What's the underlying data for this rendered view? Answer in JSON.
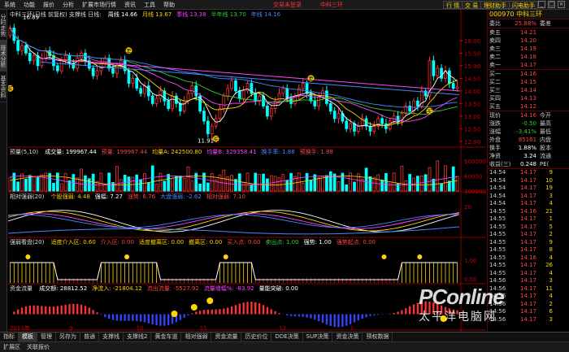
{
  "menubar": {
    "items": [
      "系统",
      "功能",
      "报价",
      "分析",
      "扩展市场行情",
      "资讯",
      "工具",
      "帮助"
    ],
    "login": "交易未登录",
    "company": "中科三环",
    "buttons": [
      "行 情",
      "交 易",
      "理财助手",
      "闪电助手"
    ]
  },
  "left_tabs": [
    "分时走势",
    "技术分析",
    "基本资料"
  ],
  "kline": {
    "title": "中科三环(日线 前复权) 支撑线 日线:",
    "ma_labels": [
      {
        "name": "周线",
        "value": "14.66",
        "color": "#ffffff"
      },
      {
        "name": "月线",
        "value": "13.67",
        "color": "#ffd400"
      },
      {
        "name": "季线",
        "value": "13.38",
        "color": "#ff44ff"
      },
      {
        "name": "半年线",
        "value": "13.70",
        "color": "#33cc33"
      },
      {
        "name": "年线",
        "value": "14.16",
        "color": "#4488ff"
      }
    ],
    "high_label": "16.89",
    "low_label": "11.91",
    "y_ticks": [
      "16.00",
      "15.50",
      "15.00",
      "14.50",
      "14.00",
      "13.50",
      "13.00",
      "12.50",
      "12.00"
    ],
    "series": {
      "open": [
        16.2,
        16.5,
        16.0,
        15.6,
        15.8,
        15.5,
        15.2,
        15.4,
        15.0,
        15.3,
        15.6,
        15.4,
        15.0,
        14.8,
        15.2,
        15.4,
        15.1,
        14.9,
        15.3,
        15.5,
        15.2,
        14.9,
        14.6,
        14.8,
        15.1,
        15.3,
        14.9,
        14.7,
        15.0,
        15.2,
        14.8,
        14.3,
        14.5,
        14.1,
        13.9,
        14.2,
        13.8,
        13.5,
        13.7,
        14.0,
        13.6,
        13.3,
        13.8,
        13.5,
        13.2,
        13.6,
        13.9,
        14.2,
        13.8,
        13.2,
        12.8,
        12.3,
        12.6,
        12.9,
        13.3,
        13.8,
        14.1,
        14.4,
        14.0,
        13.7,
        14.0,
        14.3,
        13.9,
        13.6,
        13.8,
        13.4,
        13.0,
        13.3,
        13.6,
        13.9,
        14.1,
        13.7,
        13.5,
        13.8,
        14.1,
        14.3,
        13.9,
        13.6,
        13.4,
        13.8,
        14.0,
        13.5,
        13.2,
        12.9,
        13.1,
        12.8,
        12.5,
        12.7,
        12.4,
        12.6,
        12.9,
        12.6,
        12.4,
        12.6,
        12.9,
        12.7,
        12.5,
        12.8,
        13.0,
        12.8,
        13.1,
        13.4,
        13.2,
        13.6,
        13.4,
        14.0,
        13.8,
        15.2,
        14.6,
        14.9,
        14.5,
        14.8,
        14.3,
        14.1
      ],
      "close": [
        16.5,
        16.0,
        15.6,
        15.8,
        15.5,
        15.2,
        15.4,
        15.0,
        15.3,
        15.6,
        15.4,
        15.0,
        14.8,
        15.2,
        15.4,
        15.1,
        14.9,
        15.3,
        15.5,
        15.2,
        14.9,
        14.6,
        14.8,
        15.1,
        15.3,
        14.9,
        14.7,
        15.0,
        15.2,
        14.8,
        14.3,
        14.5,
        14.1,
        13.9,
        14.2,
        13.8,
        13.5,
        13.7,
        14.0,
        13.6,
        13.3,
        13.8,
        13.5,
        13.2,
        13.6,
        13.9,
        14.2,
        13.8,
        13.2,
        12.8,
        12.3,
        12.6,
        12.9,
        13.3,
        13.8,
        14.1,
        14.4,
        14.0,
        13.7,
        14.0,
        14.3,
        13.9,
        13.6,
        13.8,
        13.4,
        13.0,
        13.3,
        13.6,
        13.9,
        14.1,
        13.7,
        13.5,
        13.8,
        14.1,
        14.3,
        13.9,
        13.6,
        13.4,
        13.8,
        14.0,
        13.5,
        13.2,
        12.9,
        13.1,
        12.8,
        12.5,
        12.7,
        12.4,
        12.6,
        12.9,
        12.6,
        12.4,
        12.6,
        12.9,
        12.7,
        12.5,
        12.8,
        13.0,
        12.8,
        13.1,
        13.4,
        13.2,
        13.6,
        13.4,
        14.0,
        13.8,
        15.2,
        14.6,
        14.9,
        14.5,
        14.8,
        14.3,
        14.1,
        14.16
      ]
    },
    "annotations": [
      {
        "label": "买",
        "index": 0,
        "price": 14.1,
        "color": "#ffd400"
      },
      {
        "label": "卖",
        "index": 30,
        "price": 15.6,
        "color": "#ffd400"
      },
      {
        "label": "买",
        "index": 52,
        "price": 12.1,
        "color": "#ffd400"
      },
      {
        "label": "卖",
        "index": 76,
        "price": 14.5,
        "color": "#ffd400"
      },
      {
        "label": "买",
        "index": 106,
        "price": 13.2,
        "color": "#ffd400"
      }
    ]
  },
  "volume": {
    "title": "预量(5,10)",
    "labels": [
      {
        "name": "成交量:",
        "value": "199967.44",
        "color": "#ffffff"
      },
      {
        "name": "预量:",
        "value": "199967.44",
        "color": "#ff4444"
      },
      {
        "name": "均量A:",
        "value": "242500.80",
        "color": "#ffd400"
      },
      {
        "name": "均量B:",
        "value": "329358.41",
        "color": "#ff44ff"
      },
      {
        "name": "换手率:",
        "value": "1.88",
        "color": "#4488ff"
      },
      {
        "name": "预换手:",
        "value": "1.88",
        "color": "#ff4444"
      }
    ],
    "y_ticks": [
      "900000",
      "60000",
      "300000"
    ]
  },
  "rsi": {
    "title": "相对强弱(20)",
    "labels": [
      {
        "name": "个股强弱:",
        "value": "4.48",
        "color": "#ffd400"
      },
      {
        "name": "强幅:",
        "value": "7.27",
        "color": "#ffffff"
      },
      {
        "name": "涨势:",
        "value": "6.76",
        "color": "#ff4444"
      },
      {
        "name": "大盘强弱:",
        "value": "-2.62",
        "color": "#4488ff"
      },
      {
        "name": "相对强弱:",
        "value": "7.10",
        "color": "#ff4444"
      }
    ],
    "y_ticks": [
      "20"
    ]
  },
  "strength": {
    "title": "强弱看盘(20)",
    "labels": [
      {
        "name": "适度介入区:",
        "value": "0.60",
        "color": "#ffd400"
      },
      {
        "name": "介入区:",
        "value": "0.00",
        "color": "#ff4444"
      },
      {
        "name": "适度撤离区:",
        "value": "0.00",
        "color": "#ffd400"
      },
      {
        "name": "撤离区:",
        "value": "0.00",
        "color": "#ffd400"
      },
      {
        "name": "买入点:",
        "value": "0.00",
        "color": "#ff4444"
      },
      {
        "name": "卖出点:",
        "value": "1.00",
        "color": "#33cc33"
      },
      {
        "name": "强势:",
        "value": "1.00",
        "color": "#ffffff"
      },
      {
        "name": "强势起点:",
        "value": "0.00",
        "color": "#ff4444"
      }
    ],
    "y_ticks": [
      "1.00",
      "0.00"
    ]
  },
  "money": {
    "title": "资金流量",
    "labels": [
      {
        "name": "成交额:",
        "value": "28812.52",
        "color": "#ffffff"
      },
      {
        "name": "净流入:",
        "value": "-21804.12",
        "color": "#ffd400"
      },
      {
        "name": "流出流量:",
        "value": "-5527.92",
        "color": "#ff4444"
      },
      {
        "name": "流量增幅%:",
        "value": "-83.92",
        "color": "#ff44ff"
      },
      {
        "name": "量能突破:",
        "value": "0.00",
        "color": "#ffffff"
      }
    ]
  },
  "x_axis": [
    "2013年",
    "9",
    "10",
    "11",
    "12",
    "1"
  ],
  "right_panel": {
    "title_code": "000970",
    "title_name": "中科三环",
    "weibi_label": "委比",
    "weibi_value": "25.88%",
    "weibi_extra": "委差",
    "sell": [
      {
        "label": "卖五",
        "price": "14.21"
      },
      {
        "label": "卖四",
        "price": "14.20"
      },
      {
        "label": "卖三",
        "price": "14.19"
      },
      {
        "label": "卖二",
        "price": "14.18"
      },
      {
        "label": "卖一",
        "price": "14.17"
      }
    ],
    "buy": [
      {
        "label": "买一",
        "price": "14.16"
      },
      {
        "label": "买二",
        "price": "14.15"
      },
      {
        "label": "买三",
        "price": "14.14"
      },
      {
        "label": "买四",
        "price": "14.13"
      },
      {
        "label": "买五",
        "price": "14.12"
      }
    ],
    "quotes": [
      {
        "label": "现价",
        "value": "14.16",
        "extra": "今开",
        "color": "#ff4444"
      },
      {
        "label": "涨跌",
        "value": "-0.50",
        "extra": "最高",
        "color": "#33cc33"
      },
      {
        "label": "涨幅",
        "value": "-3.41%",
        "extra": "最低",
        "color": "#33cc33"
      },
      {
        "label": "外盘",
        "value": "85161",
        "extra": "内盘",
        "color": "#ff4444"
      },
      {
        "label": "换手",
        "value": "1.88%",
        "extra": "股本",
        "color": "#ffffff"
      },
      {
        "label": "净资",
        "value": "3.24",
        "extra": "流通",
        "color": "#ffffff"
      },
      {
        "label": "收益(三)",
        "value": "0.248",
        "extra": "PE(",
        "color": "#ffffff"
      }
    ],
    "ticks": [
      {
        "time": "14:54",
        "price": "14.17",
        "vol": "9"
      },
      {
        "time": "14:54",
        "price": "14.17",
        "vol": "10"
      },
      {
        "time": "14:54",
        "price": "14.17",
        "vol": "19"
      },
      {
        "time": "14:54",
        "price": "14.17",
        "vol": "3"
      },
      {
        "time": "14:54",
        "price": "14.17",
        "vol": "4"
      },
      {
        "time": "14:55",
        "price": "14.16",
        "vol": "21"
      },
      {
        "time": "14:55",
        "price": "14.17",
        "vol": "1"
      },
      {
        "time": "14:55",
        "price": "14.17",
        "vol": "5"
      },
      {
        "time": "14:55",
        "price": "14.17",
        "vol": "2"
      },
      {
        "time": "14:55",
        "price": "14.17",
        "vol": "9"
      },
      {
        "time": "14:55",
        "price": "14.17",
        "vol": "8"
      },
      {
        "time": "14:55",
        "price": "14.16",
        "vol": "4"
      },
      {
        "time": "14:55",
        "price": "14.17",
        "vol": "26"
      },
      {
        "time": "14:55",
        "price": "14.17",
        "vol": "4"
      },
      {
        "time": "14:56",
        "price": "14.17",
        "vol": "3"
      },
      {
        "time": "14:56",
        "price": "14.17",
        "vol": "11"
      },
      {
        "time": "14:56",
        "price": "14.17",
        "vol": "4"
      },
      {
        "time": "14:56",
        "price": "14.17",
        "vol": "2"
      },
      {
        "time": "14:56",
        "price": "14.17",
        "vol": "6"
      },
      {
        "time": "14:56",
        "price": "14.17",
        "vol": "3"
      }
    ]
  },
  "bottom_tabs": [
    "指标",
    "模板",
    "管理",
    "另存为",
    "普通",
    "支撑线",
    "支撑线2",
    "黄金车道",
    "相对强弱",
    "资金流量",
    "历史价位",
    "DDE决策",
    "SUP决策",
    "资金决策",
    "预权数据"
  ],
  "status_items": [
    "扩展区",
    "关联报价"
  ],
  "watermark": {
    "brand": "PConline",
    "cn": "太平洋电脑网"
  }
}
